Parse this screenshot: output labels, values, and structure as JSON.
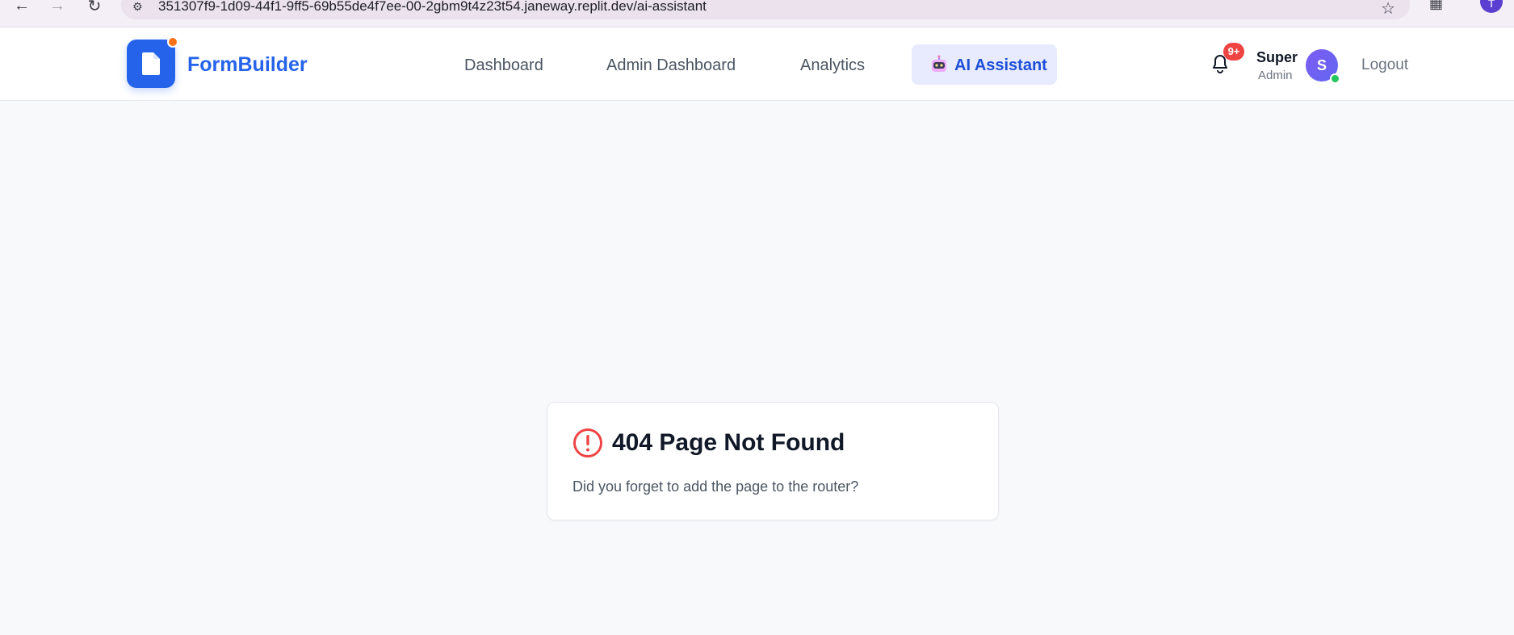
{
  "browser": {
    "url": "351307f9-1d09-44f1-9ff5-69b55de4f7ee-00-2gbm9t4z23t54.janeway.replit.dev/ai-assistant",
    "profile_initial": "T"
  },
  "header": {
    "brand": "FormBuilder",
    "nav": {
      "dashboard": "Dashboard",
      "admin_dashboard": "Admin Dashboard",
      "analytics": "Analytics",
      "ai_assistant": "AI Assistant"
    },
    "notifications_badge": "9+",
    "user": {
      "name": "Super",
      "role": "Admin",
      "initial": "S"
    },
    "logout": "Logout"
  },
  "error_card": {
    "title": "404 Page Not Found",
    "message": "Did you forget to add the page to the router?"
  },
  "colors": {
    "brand": "#2563eb",
    "error": "#ef4444",
    "active_nav_bg": "#e7ebfd",
    "status_online": "#22c55e"
  }
}
